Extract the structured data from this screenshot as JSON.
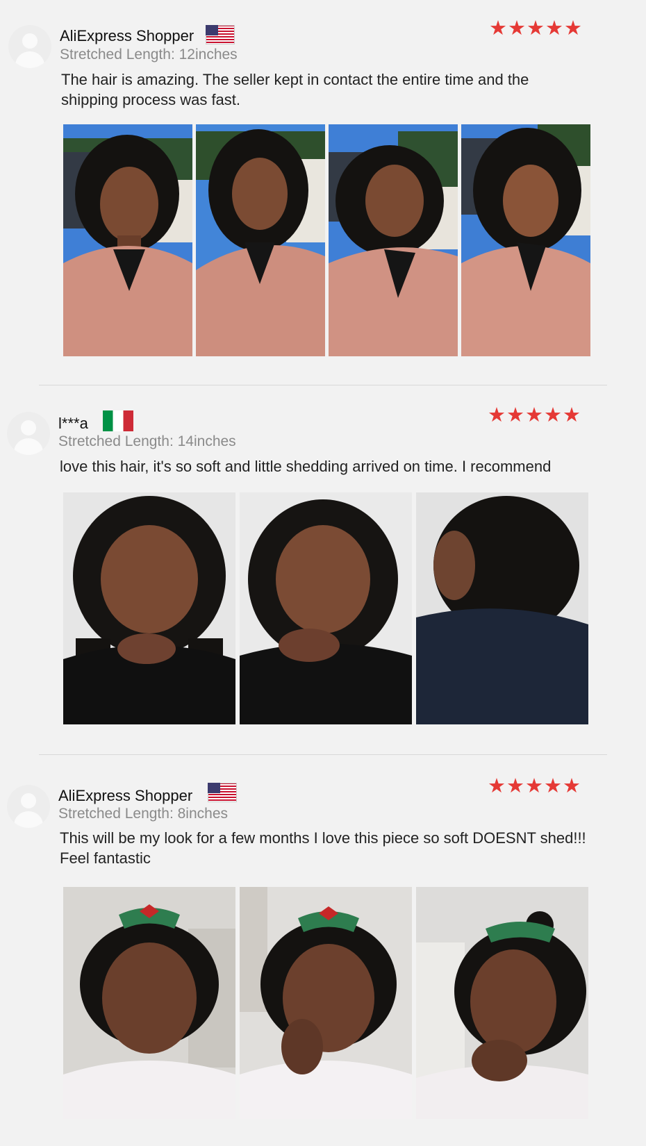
{
  "reviews": [
    {
      "reviewer": "AliExpress Shopper",
      "country_flag": "us-flag-icon",
      "stretched_length": "Stretched Length: 12inches",
      "text": "The hair is amazing. The seller kept in contact the entire time and the shipping process was fast.",
      "rating_stars": "★★★★★",
      "rating": 5,
      "photo_count": 4
    },
    {
      "reviewer": "l***a",
      "country_flag": "italy-flag-icon",
      "stretched_length": "Stretched Length: 14inches",
      "text": "love this hair, it's so soft and little shedding arrived on time. I recommend",
      "rating_stars": "★★★★★",
      "rating": 5,
      "photo_count": 3
    },
    {
      "reviewer": "AliExpress Shopper",
      "country_flag": "us-flag-icon",
      "stretched_length": "Stretched Length: 8inches",
      "text": "This will be my look for a few months I love this piece so soft DOESNT shed!!! Feel fantastic",
      "rating_stars": "★★★★★",
      "rating": 5,
      "photo_count": 3
    }
  ],
  "colors": {
    "star": "#e53935",
    "background": "#f2f2f2",
    "secondary_text": "#8a8a8a"
  }
}
